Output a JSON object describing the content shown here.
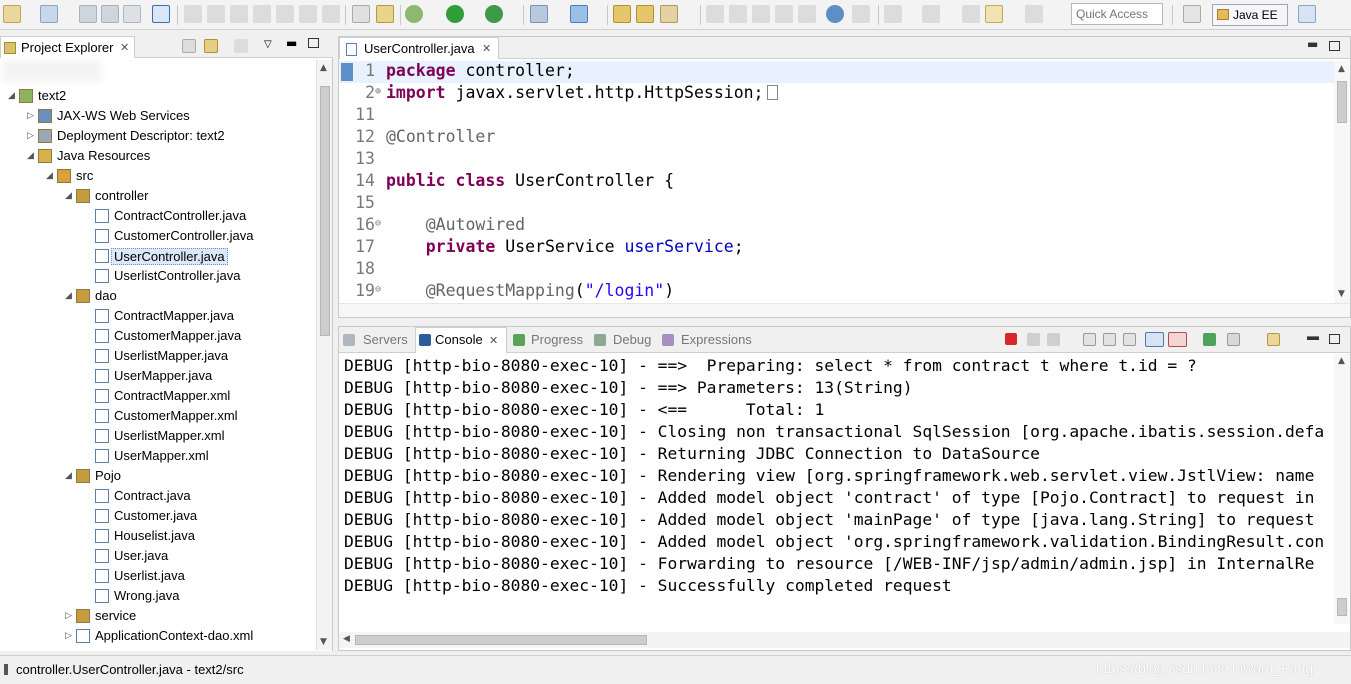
{
  "toolbar": {
    "quick_access_placeholder": "Quick Access",
    "perspective_label": "Java EE"
  },
  "project_explorer": {
    "tab_label": "Project Explorer",
    "tree": [
      {
        "label": "text2",
        "icon": "project-icon",
        "expanded": true
      },
      {
        "label": "JAX-WS Web Services",
        "icon": "webservice-icon"
      },
      {
        "label": "Deployment Descriptor: text2",
        "icon": "descriptor-icon"
      },
      {
        "label": "Java Resources",
        "icon": "java-resources-icon",
        "expanded": true
      },
      {
        "label": "src",
        "icon": "source-folder-icon",
        "expanded": true
      },
      {
        "label": "controller",
        "icon": "package-icon",
        "expanded": true
      },
      {
        "label": "ContractController.java",
        "icon": "java-file-icon"
      },
      {
        "label": "CustomerController.java",
        "icon": "java-file-icon"
      },
      {
        "label": "UserController.java",
        "icon": "java-file-icon",
        "selected": true
      },
      {
        "label": "UserlistController.java",
        "icon": "java-file-icon"
      },
      {
        "label": "dao",
        "icon": "package-icon",
        "expanded": true
      },
      {
        "label": "ContractMapper.java",
        "icon": "java-file-icon"
      },
      {
        "label": "CustomerMapper.java",
        "icon": "java-file-icon"
      },
      {
        "label": "UserlistMapper.java",
        "icon": "java-file-icon"
      },
      {
        "label": "UserMapper.java",
        "icon": "java-file-icon"
      },
      {
        "label": "ContractMapper.xml",
        "icon": "xml-file-icon"
      },
      {
        "label": "CustomerMapper.xml",
        "icon": "xml-file-icon"
      },
      {
        "label": "UserlistMapper.xml",
        "icon": "xml-file-icon"
      },
      {
        "label": "UserMapper.xml",
        "icon": "xml-file-icon"
      },
      {
        "label": "Pojo",
        "icon": "package-icon",
        "expanded": true
      },
      {
        "label": "Contract.java",
        "icon": "java-file-icon"
      },
      {
        "label": "Customer.java",
        "icon": "java-file-icon"
      },
      {
        "label": "Houselist.java",
        "icon": "java-file-icon"
      },
      {
        "label": "User.java",
        "icon": "java-file-icon"
      },
      {
        "label": "Userlist.java",
        "icon": "java-file-icon"
      },
      {
        "label": "Wrong.java",
        "icon": "java-file-icon"
      },
      {
        "label": "service",
        "icon": "package-icon"
      },
      {
        "label": "ApplicationContext-dao.xml",
        "icon": "xml-file-icon"
      }
    ]
  },
  "editor": {
    "tab_label": "UserController.java",
    "lines": [
      {
        "num": "1",
        "segments": [
          {
            "t": "package",
            "c": "kw"
          },
          {
            "t": " controller;"
          }
        ]
      },
      {
        "num": "2",
        "fold": true,
        "segments": [
          {
            "t": "import",
            "c": "kw"
          },
          {
            "t": " javax.servlet.http.HttpSession;"
          }
        ]
      },
      {
        "num": "11",
        "segments": []
      },
      {
        "num": "12",
        "segments": [
          {
            "t": "@Controller",
            "c": "an"
          }
        ]
      },
      {
        "num": "13",
        "segments": []
      },
      {
        "num": "14",
        "segments": [
          {
            "t": "public",
            "c": "kw"
          },
          {
            "t": " "
          },
          {
            "t": "class",
            "c": "kw"
          },
          {
            "t": " UserController {"
          }
        ]
      },
      {
        "num": "15",
        "segments": []
      },
      {
        "num": "16",
        "fold": true,
        "segments": [
          {
            "t": "    "
          },
          {
            "t": "@Autowired",
            "c": "an"
          }
        ]
      },
      {
        "num": "17",
        "segments": [
          {
            "t": "    "
          },
          {
            "t": "private",
            "c": "kw"
          },
          {
            "t": " UserService "
          },
          {
            "t": "userService",
            "c": "fd"
          },
          {
            "t": ";"
          }
        ]
      },
      {
        "num": "18",
        "segments": []
      },
      {
        "num": "19",
        "fold": true,
        "segments": [
          {
            "t": "    "
          },
          {
            "t": "@RequestMapping",
            "c": "an"
          },
          {
            "t": "("
          },
          {
            "t": "\"/login\"",
            "c": "st"
          },
          {
            "t": ")"
          }
        ]
      }
    ]
  },
  "console": {
    "tabs": [
      {
        "label": "Servers",
        "icon": "servers-icon"
      },
      {
        "label": "Console",
        "icon": "console-icon",
        "active": true
      },
      {
        "label": "Progress",
        "icon": "progress-icon"
      },
      {
        "label": "Debug",
        "icon": "debug-icon"
      },
      {
        "label": "Expressions",
        "icon": "expressions-icon"
      }
    ],
    "lines": [
      "DEBUG [http-bio-8080-exec-10] - ==>  Preparing: select * from contract t where t.id = ?",
      "DEBUG [http-bio-8080-exec-10] - ==> Parameters: 13(String)",
      "DEBUG [http-bio-8080-exec-10] - <==      Total: 1",
      "DEBUG [http-bio-8080-exec-10] - Closing non transactional SqlSession [org.apache.ibatis.session.defa",
      "DEBUG [http-bio-8080-exec-10] - Returning JDBC Connection to DataSource",
      "DEBUG [http-bio-8080-exec-10] - Rendering view [org.springframework.web.servlet.view.JstlView: name",
      "DEBUG [http-bio-8080-exec-10] - Added model object 'contract' of type [Pojo.Contract] to request in",
      "DEBUG [http-bio-8080-exec-10] - Added model object 'mainPage' of type [java.lang.String] to request",
      "DEBUG [http-bio-8080-exec-10] - Added model object 'org.springframework.validation.BindingResult.con",
      "DEBUG [http-bio-8080-exec-10] - Forwarding to resource [/WEB-INF/jsp/admin/admin.jsp] in InternalRe",
      "DEBUG [http-bio-8080-exec-10] - Successfully completed request"
    ]
  },
  "statusbar": {
    "text": "controller.UserController.java - text2/src",
    "watermark": "https://blog.csdn.net/Howard_Fang"
  },
  "colors": {
    "keyword": "#7f0055",
    "annotation": "#646464",
    "string": "#2a00ff",
    "field": "#0000c0",
    "line_highlight": "#e8f2fe",
    "selection": "#dbe8f6"
  }
}
